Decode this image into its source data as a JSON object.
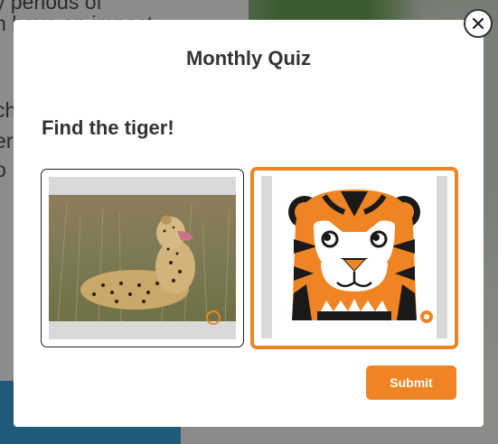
{
  "background": {
    "text_lines": [
      "y periods of",
      "n have an impact",
      "",
      "",
      "ch",
      "er",
      "o"
    ]
  },
  "modal": {
    "title": "Monthly Quiz",
    "question": "Find the tiger!",
    "submit_label": "Submit",
    "close_icon": "close-icon",
    "options": [
      {
        "image": "cheetah-photo",
        "selected": false
      },
      {
        "image": "tiger-illustration",
        "selected": true
      }
    ],
    "accent_color": "#ef8424"
  }
}
